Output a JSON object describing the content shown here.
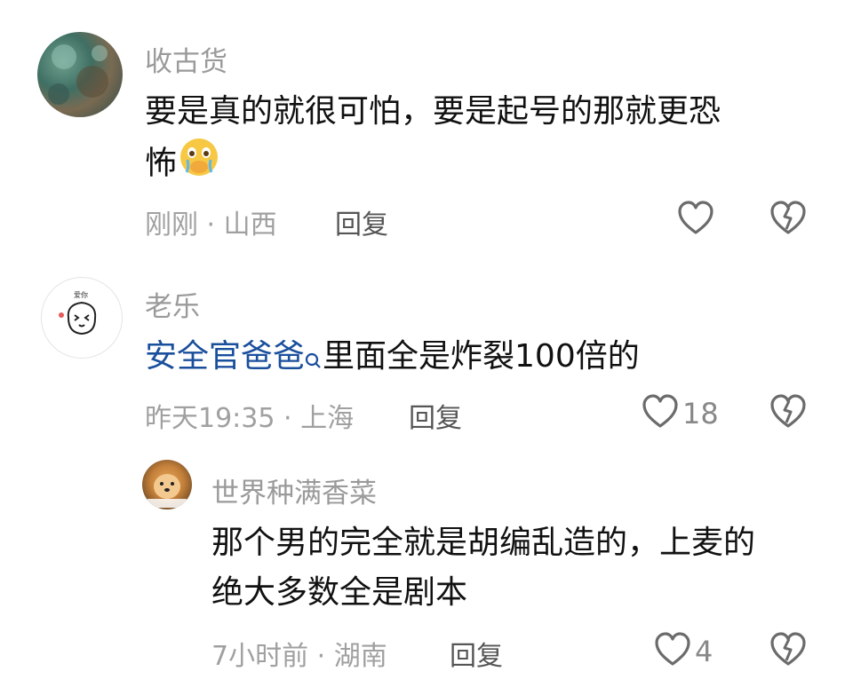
{
  "comments": [
    {
      "author": "收古货",
      "text": "要是真的就很可怕，要是起号的那就更恐怖",
      "text_line1": "要是真的就很可怕，要是起号的那就更恐",
      "text_line2": "怖",
      "emoji": "crying-face-emoji",
      "time": "刚刚",
      "location": "山西",
      "meta": "刚刚 · 山西",
      "reply_label": "回复",
      "likes": ""
    },
    {
      "author": "老乐",
      "mention": "安全官爸爸",
      "text": "里面全是炸裂100倍的",
      "time": "昨天19:35",
      "location": "上海",
      "meta": "昨天19:35 · 上海",
      "reply_label": "回复",
      "likes": "18"
    },
    {
      "author": "世界种满香菜",
      "text": "那个男的完全就是胡编乱造的，上麦的绝大多数全是剧本",
      "text_line1": "那个男的完全就是胡编乱造的，上麦的",
      "text_line2": "绝大多数全是剧本",
      "time": "7小时前",
      "location": "湖南",
      "meta": "7小时前 · 湖南",
      "reply_label": "回复",
      "likes": "4"
    }
  ],
  "colors": {
    "mention": "#1a4f9c",
    "meta": "#a0a0a0",
    "icon": "#6b6b6b"
  }
}
